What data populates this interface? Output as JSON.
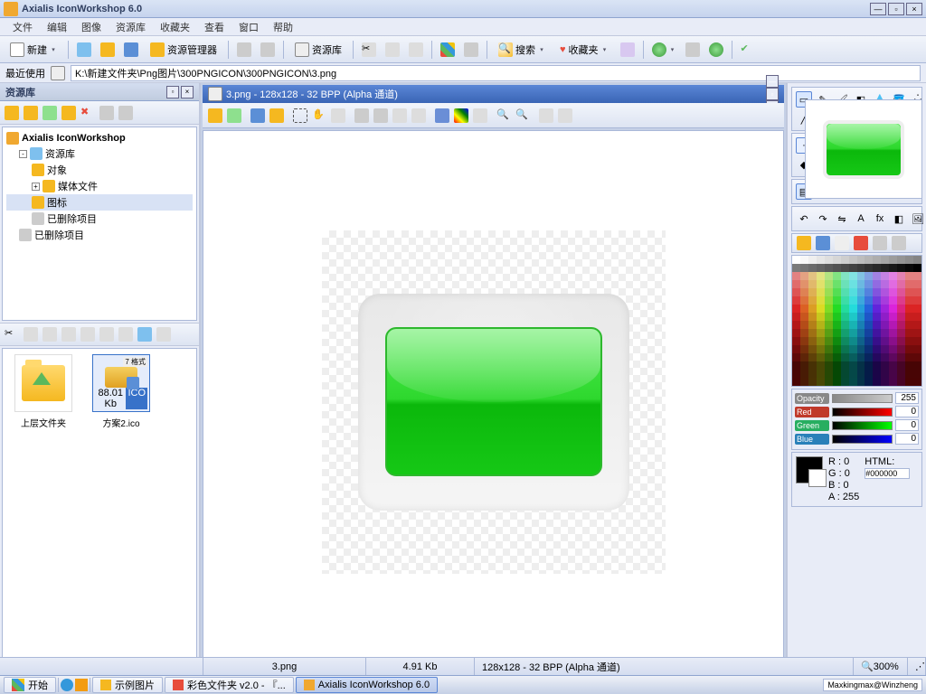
{
  "app": {
    "title": "Axialis IconWorkshop 6.0"
  },
  "menu": [
    "文件",
    "编辑",
    "图像",
    "资源库",
    "收藏夹",
    "查看",
    "窗口",
    "帮助"
  ],
  "toolbar": {
    "new": "新建",
    "resmgr": "资源管理器",
    "reslib": "资源库",
    "search": "搜索",
    "favorites": "收藏夹"
  },
  "pathbar": {
    "label": "最近使用",
    "path": "K:\\新建文件夹\\Png图片\\300PNGICON\\300PNGICON\\3.png"
  },
  "leftpanel": {
    "title": "资源库",
    "tree": {
      "root": "Axialis IconWorkshop",
      "n1": "资源库",
      "n2": "对象",
      "n3": "媒体文件",
      "n4": "图标",
      "n5": "已删除项目",
      "n6": "已删除项目"
    },
    "thumbs": {
      "up": "上层文件夹",
      "file": "方案2.ico",
      "badge": "7 格式",
      "size": "88.01 Kb",
      "ext": "ICO"
    }
  },
  "doc": {
    "title": "3.png - 128x128 - 32 BPP (Alpha 通道)"
  },
  "sliders": {
    "opacity": "Opacity",
    "opv": "255",
    "r": "R",
    "rv": "0",
    "g": "G",
    "gv": "0",
    "b": "B",
    "bv": "0"
  },
  "color": {
    "r": "R :  0",
    "g": "G :  0",
    "b": "B :  0",
    "a": "A : 255",
    "htmllbl": "HTML:",
    "html": "#000000"
  },
  "status": {
    "file": "3.png",
    "size": "4.91 Kb",
    "info": "128x128 - 32 BPP (Alpha 通道)",
    "zoom": "300%"
  },
  "taskbar": {
    "start": "开始",
    "t1": "示例图片",
    "t2": "彩色文件夹 v2.0 - 『...",
    "t3": "Axialis IconWorkshop 6.0",
    "tray": "Maxkingmax@Winzheng"
  }
}
